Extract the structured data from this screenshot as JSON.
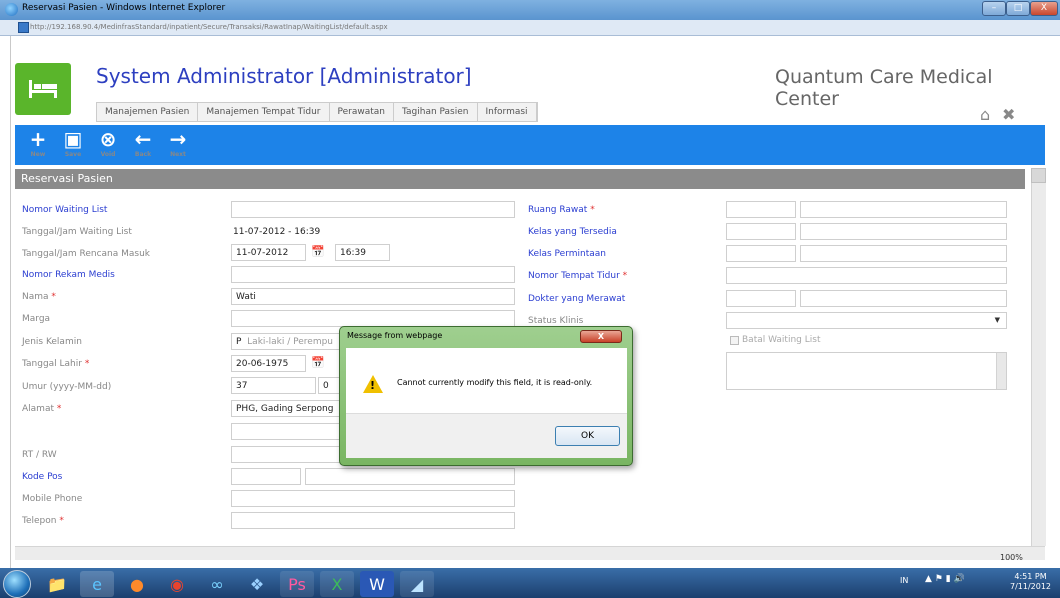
{
  "window": {
    "title": "Reservasi Pasien - Windows Internet Explorer",
    "url": "http://192.168.90.4/MedinfrasStandard/inpatient/Secure/Transaksi/RawatInap/WaitingList/default.aspx",
    "minimize": "–",
    "maximize": "□",
    "close": "X"
  },
  "header": {
    "user_title": "System Administrator [Administrator]",
    "org_name": "Quantum Care Medical Center",
    "menu": [
      "Manajemen Pasien",
      "Manajemen Tempat Tidur",
      "Perawatan",
      "Tagihan Pasien",
      "Informasi"
    ]
  },
  "toolbar": {
    "new": "New",
    "save": "Save",
    "void": "Void",
    "back": "Back",
    "next": "Next"
  },
  "section": {
    "title": "Reservasi Pasien"
  },
  "form": {
    "nomor_waiting_list_label": "Nomor Waiting List",
    "tanggal_waiting_label": "Tanggal/Jam Waiting List",
    "tanggal_waiting_value": "11-07-2012 - 16:39",
    "tanggal_rencana_label": "Tanggal/Jam Rencana Masuk",
    "tanggal_rencana_date": "11-07-2012",
    "tanggal_rencana_time": "16:39",
    "nomor_rm_label": "Nomor Rekam Medis",
    "nama_label": "Nama",
    "nama_value": "Wati",
    "marga_label": "Marga",
    "jenis_kelamin_label": "Jenis Kelamin",
    "jenis_kelamin_code": "P",
    "jenis_kelamin_text": "Laki-laki / Perempu",
    "tanggal_lahir_label": "Tanggal Lahir",
    "tanggal_lahir_value": "20-06-1975",
    "umur_label": "Umur (yyyy-MM-dd)",
    "umur_year": "37",
    "umur_month": "0",
    "alamat_label": "Alamat",
    "alamat_value": "PHG, Gading Serpong",
    "rtrw_label": "RT / RW",
    "kode_pos_label": "Kode Pos",
    "mobile_label": "Mobile Phone",
    "telepon_label": "Telepon",
    "ruang_rawat_label": "Ruang Rawat",
    "kelas_tersedia_label": "Kelas yang Tersedia",
    "kelas_permintaan_label": "Kelas Permintaan",
    "nomor_tempat_tidur_label": "Nomor Tempat Tidur",
    "dokter_label": "Dokter yang Merawat",
    "status_klinis_label": "Status Klinis",
    "batal_label": "Batal Waiting List"
  },
  "dialog": {
    "title": "Message from webpage",
    "close": "X",
    "message": "Cannot currently modify this field, it is read-only.",
    "ok": "OK"
  },
  "status": {
    "zoom": "100%"
  },
  "taskbar": {
    "lang": "IN",
    "time": "4:51 PM",
    "date": "7/11/2012"
  }
}
